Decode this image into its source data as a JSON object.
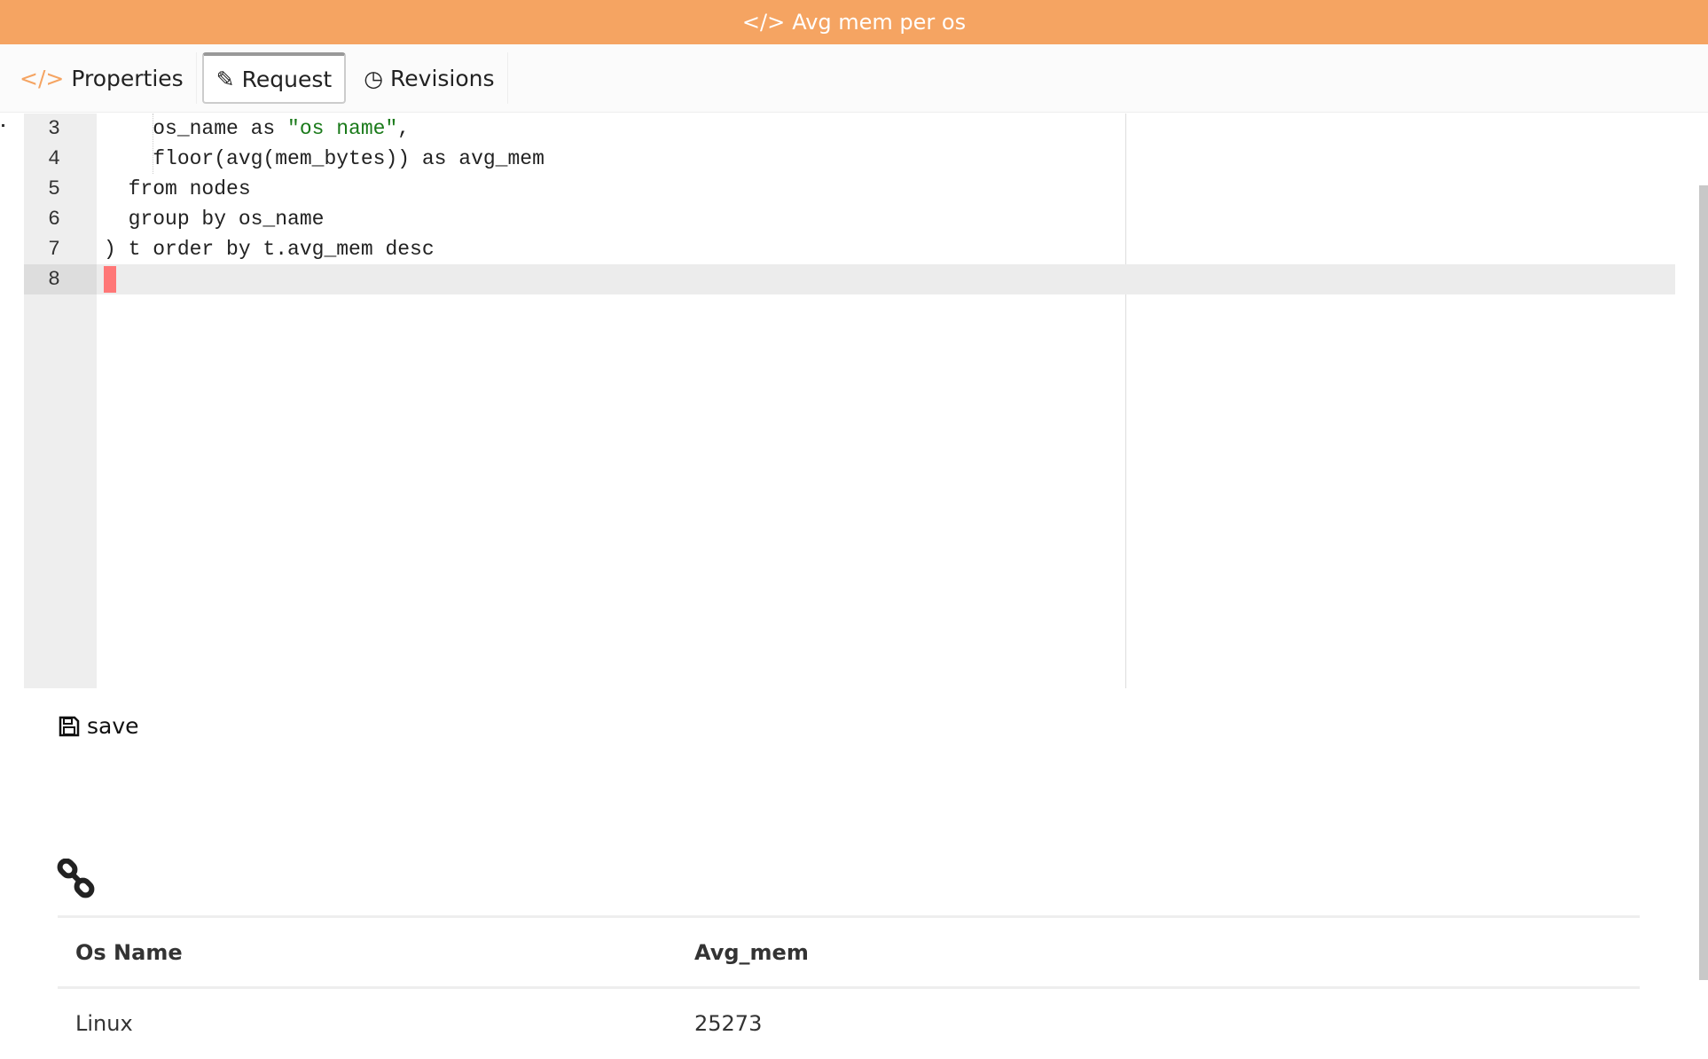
{
  "header": {
    "title": "Avg mem per os",
    "icon": "code-icon"
  },
  "tabs": [
    {
      "label": "Properties",
      "icon": "code-icon"
    },
    {
      "label": "Request",
      "icon": "pencil-icon",
      "active": true
    },
    {
      "label": "Revisions",
      "icon": "clock-icon"
    }
  ],
  "editor": {
    "lines": [
      {
        "num": "3",
        "code_a": "    os_name as ",
        "str": "\"os name\"",
        "code_b": ","
      },
      {
        "num": "4",
        "code_a": "    floor(avg(mem_bytes)) as avg_mem"
      },
      {
        "num": "5",
        "code_a": "  from nodes"
      },
      {
        "num": "6",
        "code_a": "  group by os_name"
      },
      {
        "num": "7",
        "code_a": ") t order by t.avg_mem desc"
      },
      {
        "num": "8",
        "code_a": ""
      }
    ]
  },
  "save_label": "save",
  "table": {
    "headers": [
      "Os Name",
      "Avg_mem"
    ],
    "rows": [
      [
        "Linux",
        "25273"
      ]
    ]
  }
}
